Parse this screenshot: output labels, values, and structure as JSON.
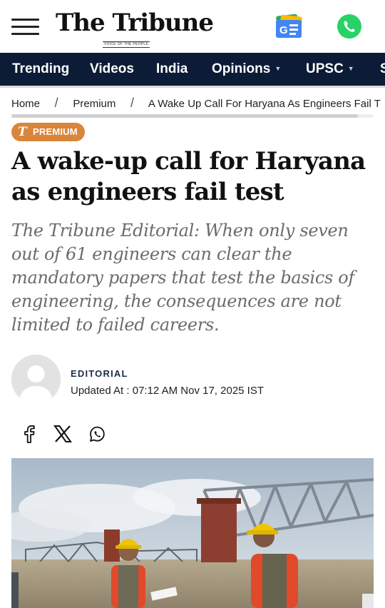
{
  "header": {
    "logo_text": "The Tribune",
    "logo_tagline": "VOICE OF THE PEOPLE"
  },
  "nav": {
    "items": [
      {
        "label": "Trending",
        "has_dropdown": false
      },
      {
        "label": "Videos",
        "has_dropdown": false
      },
      {
        "label": "India",
        "has_dropdown": false
      },
      {
        "label": "Opinions",
        "has_dropdown": true
      },
      {
        "label": "UPSC",
        "has_dropdown": true
      },
      {
        "label": "S",
        "has_dropdown": false
      }
    ]
  },
  "breadcrumb": {
    "home": "Home",
    "section": "Premium",
    "separator": "/",
    "current": "A Wake Up Call For Haryana As Engineers Fail T"
  },
  "article": {
    "badge": "PREMIUM",
    "badge_glyph": "T",
    "headline": "A wake-up call for Haryana as engineers fail test",
    "standfirst": "The Tribune Editorial: When only seven out of 61 engineers can clear the mandatory papers that test the basics of engineering, the consequences are not limited to failed careers.",
    "author": "EDITORIAL",
    "updated": "Updated At : 07:12 AM Nov 17, 2025 IST"
  },
  "share": [
    "facebook-icon",
    "x-icon",
    "whatsapp-icon"
  ],
  "colors": {
    "nav_bg": "#0c1c36",
    "badge_bg": "#d9853b",
    "author": "#1e2c49",
    "whatsapp": "#25d366"
  }
}
